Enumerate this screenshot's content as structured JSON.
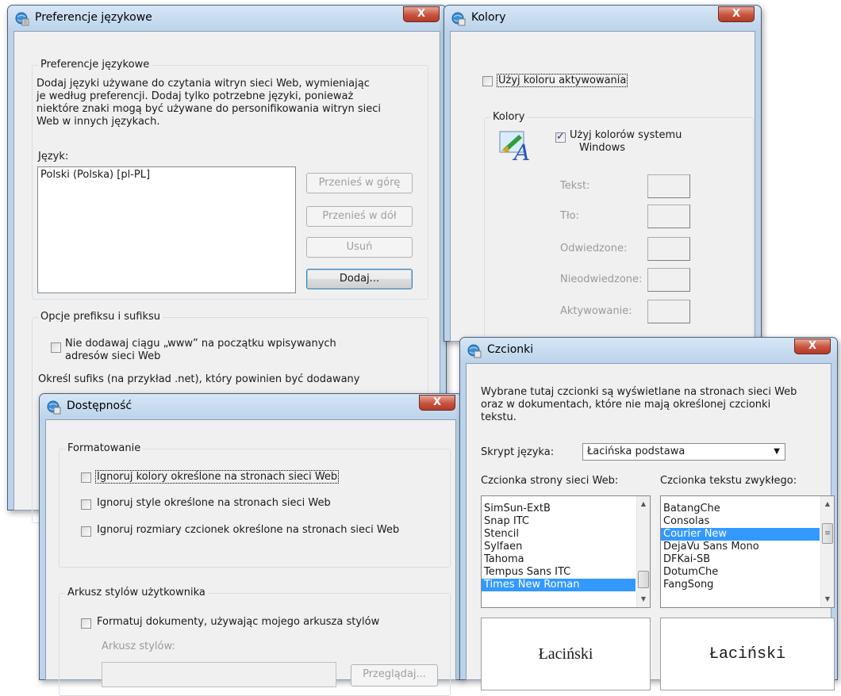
{
  "lang_dialog": {
    "title": "Preferencje językowe",
    "close_label": "X",
    "group_title": "Preferencje językowe",
    "description_lines": [
      "Dodaj języki używane do czytania witryn sieci Web, wymieniając",
      "je według preferencji. Dodaj tylko potrzebne języki, ponieważ",
      "niektóre znaki mogą być używane do personifikowania witryn sieci",
      "Web w innych językach."
    ],
    "language_label": "Język:",
    "languages": [
      "Polski (Polska) [pl-PL]"
    ],
    "move_up": "Przenieś w górę",
    "move_down": "Przenieś w dół",
    "remove": "Usuń",
    "add": "Dodaj...",
    "prefix_group_title": "Opcje prefiksu i sufiksu",
    "no_www_line1": "Nie dodawaj ciągu „www” na początku wpisywanych",
    "no_www_line2": "adresów sieci Web",
    "suffix_text": "Określ sufiks (na przykład .net), który powinien być dodawany"
  },
  "colors_dialog": {
    "title": "Kolory",
    "close_label": "X",
    "use_hover_color": "Użyj koloru aktywowania",
    "group_title": "Kolory",
    "use_windows_colors_line1": "Użyj kolorów systemu",
    "use_windows_colors_line2": "Windows",
    "use_windows_colors_checked": true,
    "text_label": "Tekst:",
    "background_label": "Tło:",
    "visited_label": "Odwiedzone:",
    "unvisited_label": "Nieodwiedzone:",
    "hover_label": "Aktywowanie:"
  },
  "accessibility_dialog": {
    "title": "Dostępność",
    "close_label": "X",
    "formatting_group": "Formatowanie",
    "ignore_colors": "Ignoruj kolory określone na stronach sieci Web",
    "ignore_styles": "Ignoruj style określone na stronach sieci Web",
    "ignore_font_sizes": "Ignoruj rozmiary czcionek określone na stronach sieci Web",
    "user_stylesheet_group": "Arkusz stylów użytkownika",
    "format_documents": "Formatuj dokumenty, używając mojego arkusza stylów",
    "stylesheet_label": "Arkusz stylów:",
    "browse": "Przeglądaj..."
  },
  "fonts_dialog": {
    "title": "Czcionki",
    "close_label": "X",
    "description_lines": [
      "Wybrane tutaj czcionki są wyświetlane na stronach sieci Web",
      "oraz w dokumentach, które nie mają określonej czcionki",
      "tekstu."
    ],
    "script_label": "Skrypt języka:",
    "script_value": "Łacińska podstawa",
    "web_font_label": "Czcionka strony sieci Web:",
    "plain_font_label": "Czcionka tekstu zwykłego:",
    "web_fonts": [
      "SimSun-ExtB",
      "Snap ITC",
      "Stencil",
      "Sylfaen",
      "Tahoma",
      "Tempus Sans ITC",
      "Times New Roman"
    ],
    "web_fonts_selected": "Times New Roman",
    "plain_fonts": [
      "BatangChe",
      "Consolas",
      "Courier New",
      "DejaVu Sans Mono",
      "DFKai-SB",
      "DotumChe",
      "FangSong"
    ],
    "plain_fonts_selected": "Courier New",
    "web_preview": "Łaciński",
    "plain_preview": "Łaciński"
  }
}
